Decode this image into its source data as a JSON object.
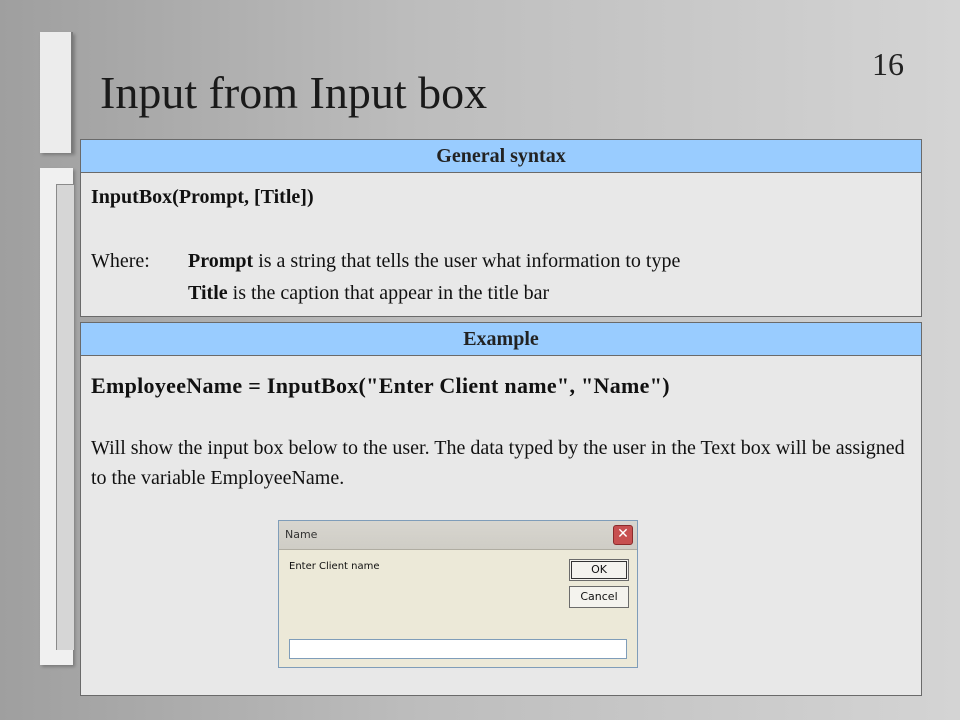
{
  "slide": {
    "page_number": "16",
    "title": "Input from Input box"
  },
  "syntax_panel": {
    "header": "General syntax",
    "syntax": "InputBox(Prompt, [Title])",
    "where_label": "Where:",
    "prompt_term": "Prompt",
    "prompt_desc": " is a string that tells the user what information to type",
    "title_term": "Title",
    "title_desc": " is the caption that appear in the title bar"
  },
  "example_panel": {
    "header": "Example",
    "code": "EmployeeName = InputBox(\"Enter Client name\", \"Name\")",
    "description": "Will show the input box below to the user. The data typed by the user in  the Text box will be assigned to  the variable EmployeeName."
  },
  "dialog": {
    "title": "Name",
    "close_glyph": "✕",
    "prompt": "Enter Client name",
    "ok_label": "OK",
    "cancel_label": "Cancel",
    "input_value": ""
  }
}
